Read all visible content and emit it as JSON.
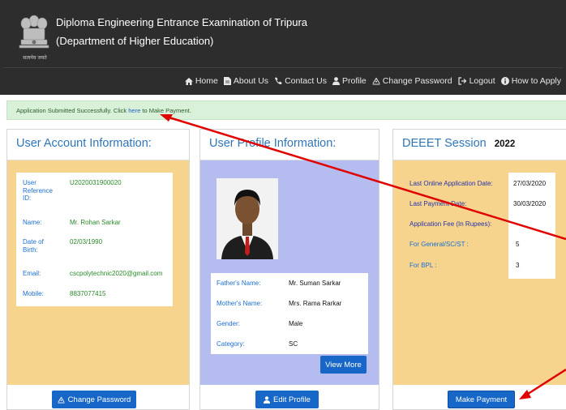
{
  "header": {
    "title_line1": "Diploma Engineering Entrance Examination of Tripura",
    "title_line2": "(Department of Higher Education)",
    "emblem_motto": "सत्यमेव जयते"
  },
  "nav": {
    "items": [
      {
        "label": "Home",
        "icon": "home-icon"
      },
      {
        "label": "About Us",
        "icon": "document-icon"
      },
      {
        "label": "Contact Us",
        "icon": "phone-icon"
      },
      {
        "label": "Profile",
        "icon": "user-icon"
      },
      {
        "label": "Change Password",
        "icon": "key-icon"
      },
      {
        "label": "Logout",
        "icon": "logout-icon"
      },
      {
        "label": "How to Apply",
        "icon": "info-icon"
      }
    ]
  },
  "alert": {
    "text_before": "Application Submitted Successfully. Click ",
    "link": "here",
    "text_after": " to Make Payment."
  },
  "account": {
    "title": "User Account Information:",
    "fields": [
      {
        "label": "User Reference ID:",
        "value": "U2020031900020"
      },
      {
        "label": "Name:",
        "value": "Mr. Rohan Sarkar"
      },
      {
        "label": "Date of Birth:",
        "value": "02/03/1990"
      },
      {
        "label": "Email:",
        "value": "cscpolytechnic2020@gmail.com"
      },
      {
        "label": "Mobile:",
        "value": "8837077415"
      }
    ],
    "button": "Change Password"
  },
  "profile": {
    "title": "User Profile Information:",
    "fields": [
      {
        "label": "Father's Name:",
        "value": "Mr. Suman Sarkar"
      },
      {
        "label": "Mother's Name:",
        "value": "Mrs. Rama Rarkar"
      },
      {
        "label": "Gender:",
        "value": "Male"
      },
      {
        "label": "Category:",
        "value": "SC"
      }
    ],
    "view_more": "View More",
    "button": "Edit Profile"
  },
  "session": {
    "title": "DEEET Session",
    "year": "2022",
    "fields": [
      {
        "label": "Last Online Application Date:",
        "value": "27/03/2020"
      },
      {
        "label": "Last Payment Date:",
        "value": "30/03/2020"
      },
      {
        "label": "Application Fee (In Rupees):",
        "value": ""
      },
      {
        "label": "For General/SC/ST :",
        "value": "5"
      },
      {
        "label": "For BPL :",
        "value": "3"
      }
    ],
    "button": "Make Payment"
  },
  "colors": {
    "header_bg": "#2d2d2d",
    "accent_blue": "#1667c7",
    "panel_yellow": "#f6d48e",
    "panel_lavender": "#b5bcef",
    "annotation_red": "#e00000"
  }
}
